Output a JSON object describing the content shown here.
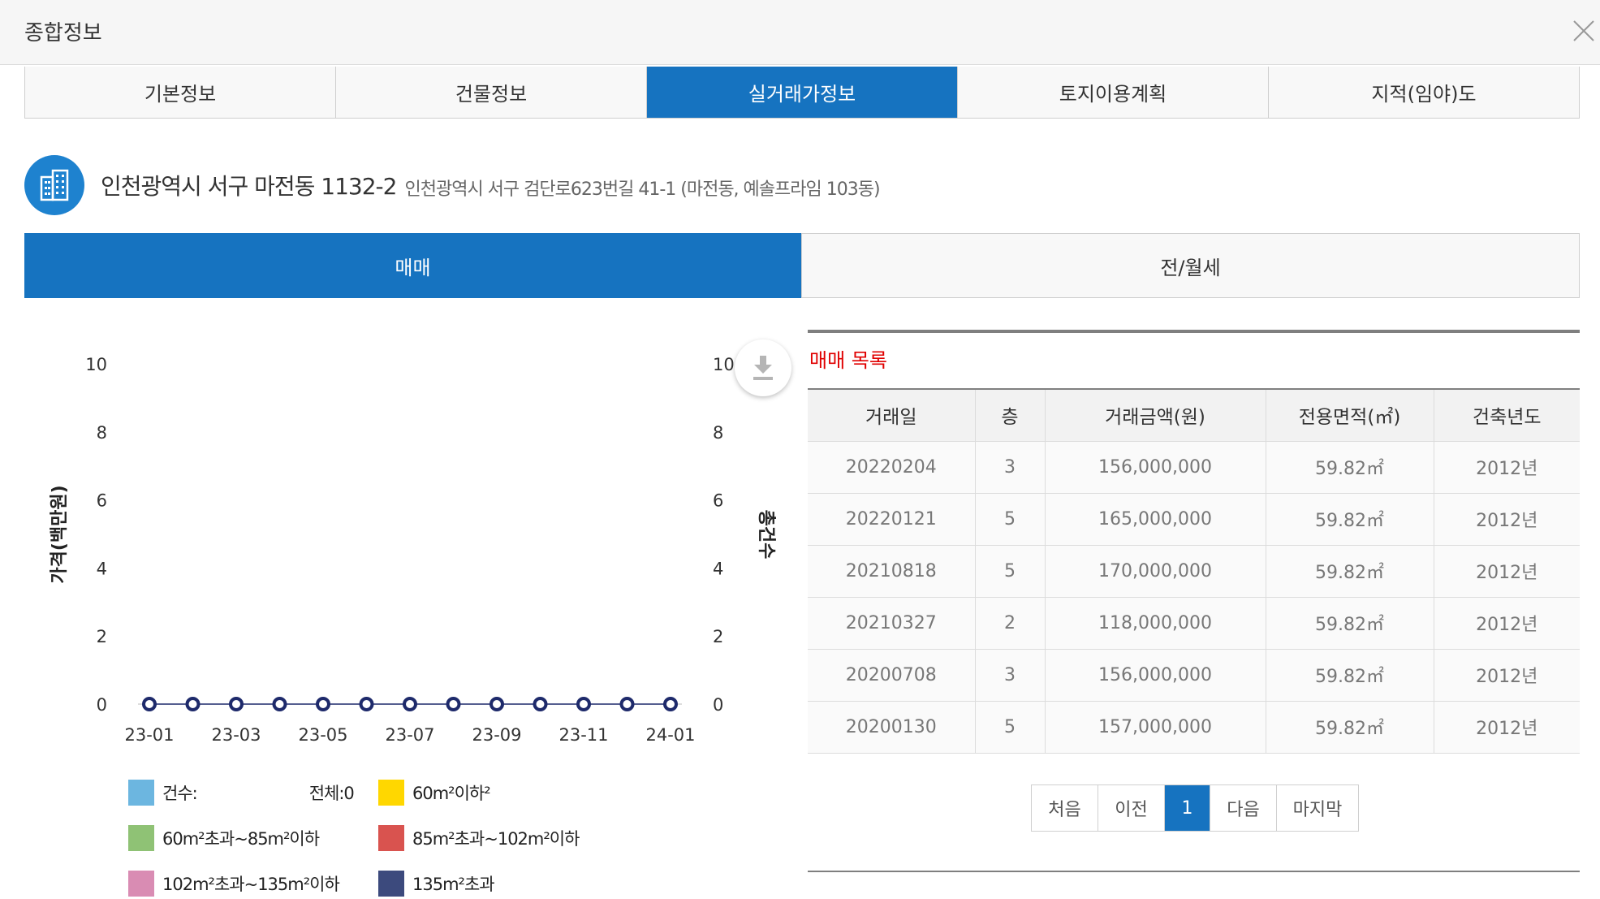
{
  "window": {
    "title": "종합정보"
  },
  "tabs": [
    {
      "label": "기본정보",
      "active": false
    },
    {
      "label": "건물정보",
      "active": false
    },
    {
      "label": "실거래가정보",
      "active": true
    },
    {
      "label": "토지이용계획",
      "active": false
    },
    {
      "label": "지적(임야)도",
      "active": false
    }
  ],
  "address": {
    "main": "인천광역시 서구 마전동 1132-2",
    "sub": "인천광역시 서구 검단로623번길 41-1 (마전동, 예솔프라임 103동)",
    "icon": "building-icon"
  },
  "subtabs": [
    {
      "label": "매매",
      "active": true
    },
    {
      "label": "전/월세",
      "active": false
    }
  ],
  "chart_data": {
    "type": "line",
    "x": [
      "23-01",
      "23-02",
      "23-03",
      "23-04",
      "23-05",
      "23-06",
      "23-07",
      "23-08",
      "23-09",
      "23-10",
      "23-11",
      "23-12",
      "24-01"
    ],
    "x_tick_labels": [
      "23-01",
      "23-03",
      "23-05",
      "23-07",
      "23-09",
      "23-11",
      "24-01"
    ],
    "series": [
      {
        "values": [
          0,
          0,
          0,
          0,
          0,
          0,
          0,
          0,
          0,
          0,
          0,
          0,
          0
        ],
        "color": "#1e2a6b"
      }
    ],
    "ylabel": "가격(백만원)",
    "y2label": "총건수",
    "ylim": [
      0,
      10
    ],
    "y2lim": [
      0,
      10
    ],
    "y_ticks": [
      "0",
      "2",
      "4",
      "6",
      "8",
      "10"
    ],
    "grid": false
  },
  "legend": {
    "count_label": "건수:",
    "total_label": "전체:0",
    "items": [
      {
        "label": "60m²이하²",
        "color": "#ffd700"
      },
      {
        "label": "60m²초과~85m²이하",
        "color": "#8fc275"
      },
      {
        "label": "85m²초과~102m²이하",
        "color": "#d9534f"
      },
      {
        "label": "102m²초과~135m²이하",
        "color": "#d98cb3"
      },
      {
        "label": "135m²초과",
        "color": "#3c4a7d"
      }
    ],
    "count_color": "#6cb6e0"
  },
  "list": {
    "title": "매매 목록",
    "columns": [
      "거래일",
      "층",
      "거래금액(원)",
      "전용면적(㎡)",
      "건축년도"
    ],
    "rows": [
      [
        "20220204",
        "3",
        "156,000,000",
        "59.82㎡",
        "2012년"
      ],
      [
        "20220121",
        "5",
        "165,000,000",
        "59.82㎡",
        "2012년"
      ],
      [
        "20210818",
        "5",
        "170,000,000",
        "59.82㎡",
        "2012년"
      ],
      [
        "20210327",
        "2",
        "118,000,000",
        "59.82㎡",
        "2012년"
      ],
      [
        "20200708",
        "3",
        "156,000,000",
        "59.82㎡",
        "2012년"
      ],
      [
        "20200130",
        "5",
        "157,000,000",
        "59.82㎡",
        "2012년"
      ]
    ]
  },
  "pager": {
    "first": "처음",
    "prev": "이전",
    "current": "1",
    "next": "다음",
    "last": "마지막"
  },
  "colors": {
    "accent": "#1673c0",
    "list_title": "#e00000"
  }
}
